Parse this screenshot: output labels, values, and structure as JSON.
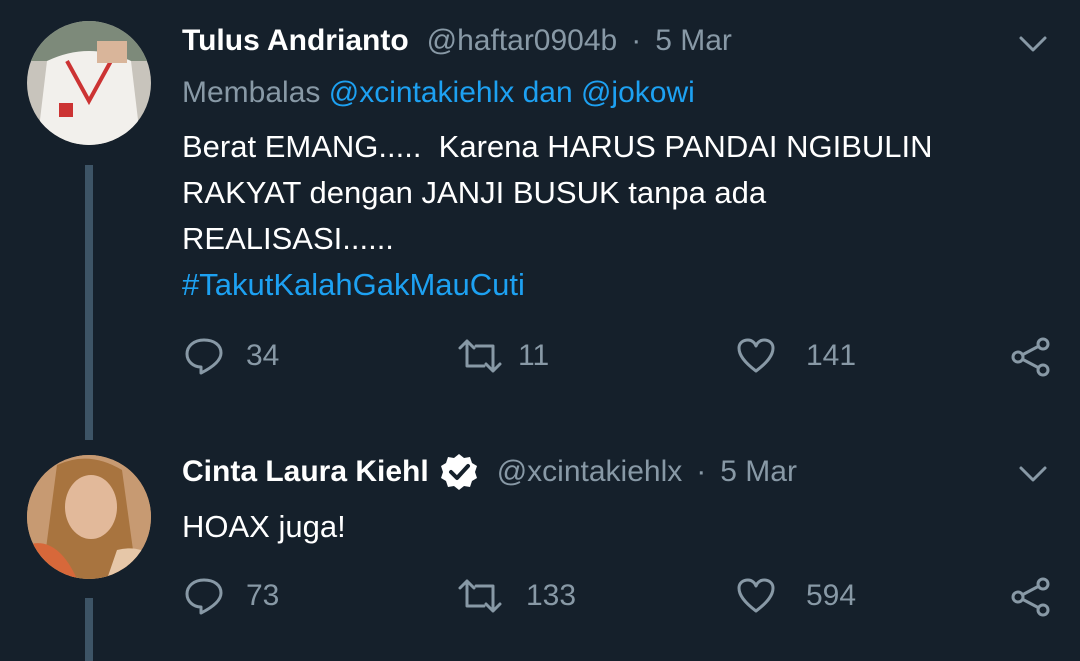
{
  "tweets": [
    {
      "name": "Tulus Andrianto",
      "handle": "@haftar0904b",
      "separator": "·",
      "date": "5 Mar",
      "reply_prefix": "Membalas",
      "reply_mentions": "@xcintakiehlx dan @jokowi",
      "text": "Berat EMANG.....  Karena HARUS PANDAI NGIBULIN\nRAKYAT dengan JANJI BUSUK tanpa ada\nREALISASI......",
      "hashtag": "#TakutKalahGakMauCuti",
      "replies": "34",
      "retweets": "11",
      "likes": "141",
      "verified": false
    },
    {
      "name": "Cinta Laura Kiehl",
      "handle": "@xcintakiehlx",
      "separator": "·",
      "date": "5 Mar",
      "text": "HOAX juga!",
      "replies": "73",
      "retweets": "133",
      "likes": "594",
      "verified": true
    }
  ],
  "icons": {
    "reply": "reply-icon",
    "retweet": "retweet-icon",
    "like": "heart-icon",
    "share": "share-icon",
    "more": "chevron-down-icon",
    "verified": "verified-badge-icon"
  },
  "colors": {
    "background": "#15202b",
    "primary_text": "#ffffff",
    "secondary_text": "#8899a6",
    "link": "#1da1f2",
    "thread_line": "#3d5466"
  }
}
